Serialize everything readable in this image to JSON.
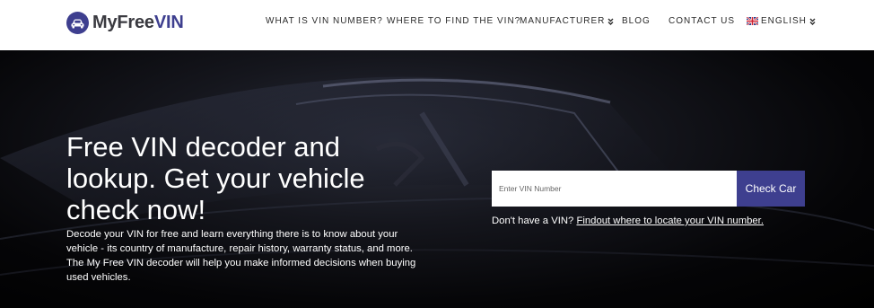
{
  "logo": {
    "text_my": "MyFree",
    "text_vin": "VIN"
  },
  "nav": {
    "what_is": "WHAT IS VIN NUMBER?",
    "where_find": "WHERE TO FIND THE VIN?",
    "manufacturer": "MANUFACTURER",
    "blog": "BLOG",
    "contact": "CONTACT US",
    "language": "ENGLISH"
  },
  "hero": {
    "headline": "Free VIN decoder and lookup. Get your vehicle check now!",
    "description": "Decode your VIN for free and learn everything there is to know about your vehicle - its country of manufacture, repair history, warranty status, and more. The My Free VIN decoder will help you make informed decisions when buying used vehicles."
  },
  "search": {
    "placeholder": "Enter VIN Number",
    "value": "",
    "button_label": "Check Car"
  },
  "help": {
    "prefix": "Don't have a VIN?",
    "link_text": "Findout where to locate your VIN number."
  },
  "colors": {
    "accent": "#3e3f8f",
    "header_bg": "#ffffff",
    "hero_bg": "#000000"
  },
  "icons": {
    "logo": "car-icon",
    "dropdown": "chevron-down-icon",
    "flag": "uk-flag-icon"
  }
}
